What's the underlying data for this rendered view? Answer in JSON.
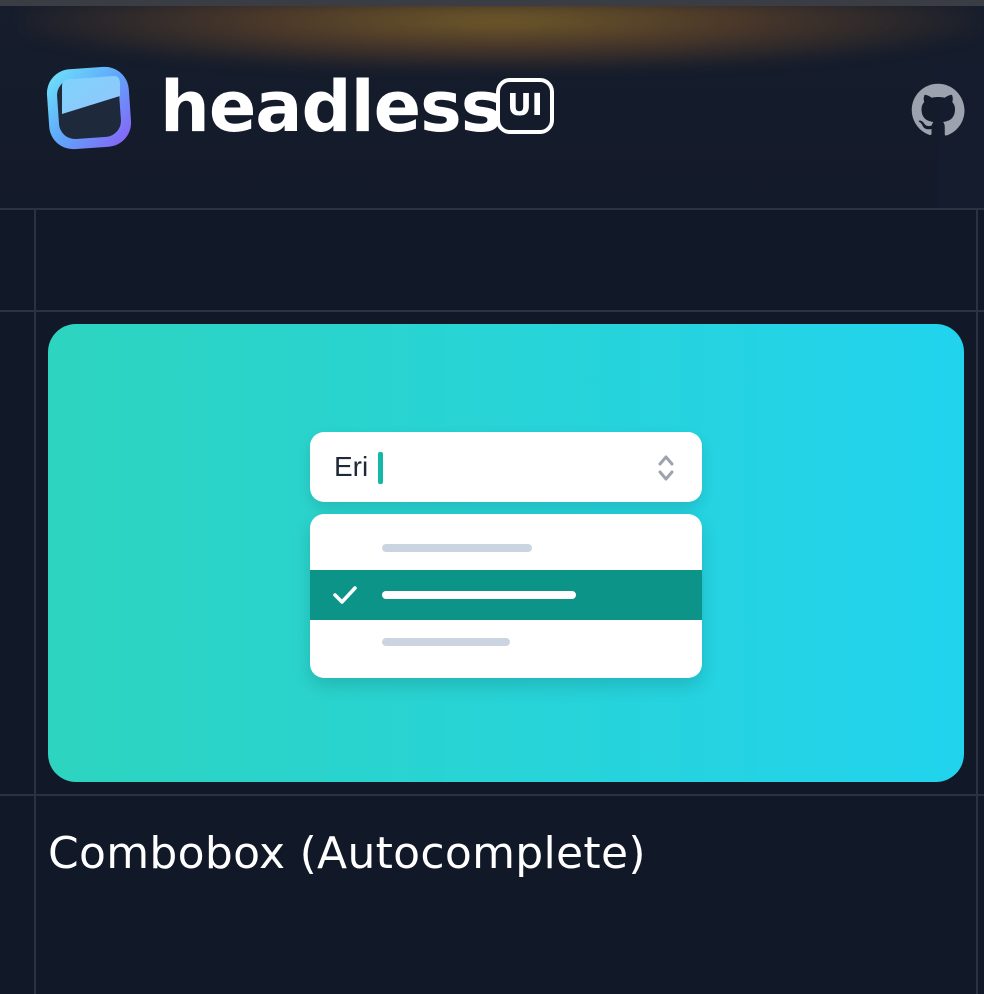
{
  "header": {
    "brand_name": "headless",
    "brand_badge": "UI",
    "logo_icon": "headless-logo-icon",
    "github_icon": "github-icon"
  },
  "card": {
    "combobox": {
      "input_value": "Eri",
      "toggle_icon": "chevron-up-down-icon"
    },
    "options": {
      "selected_index": 1,
      "check_icon": "check-icon"
    },
    "colors": {
      "gradient_start": "#2dd4bf",
      "gradient_end": "#22d3ee",
      "selected": "#0d9488"
    }
  },
  "component": {
    "title": "Combobox (Autocomplete)"
  }
}
